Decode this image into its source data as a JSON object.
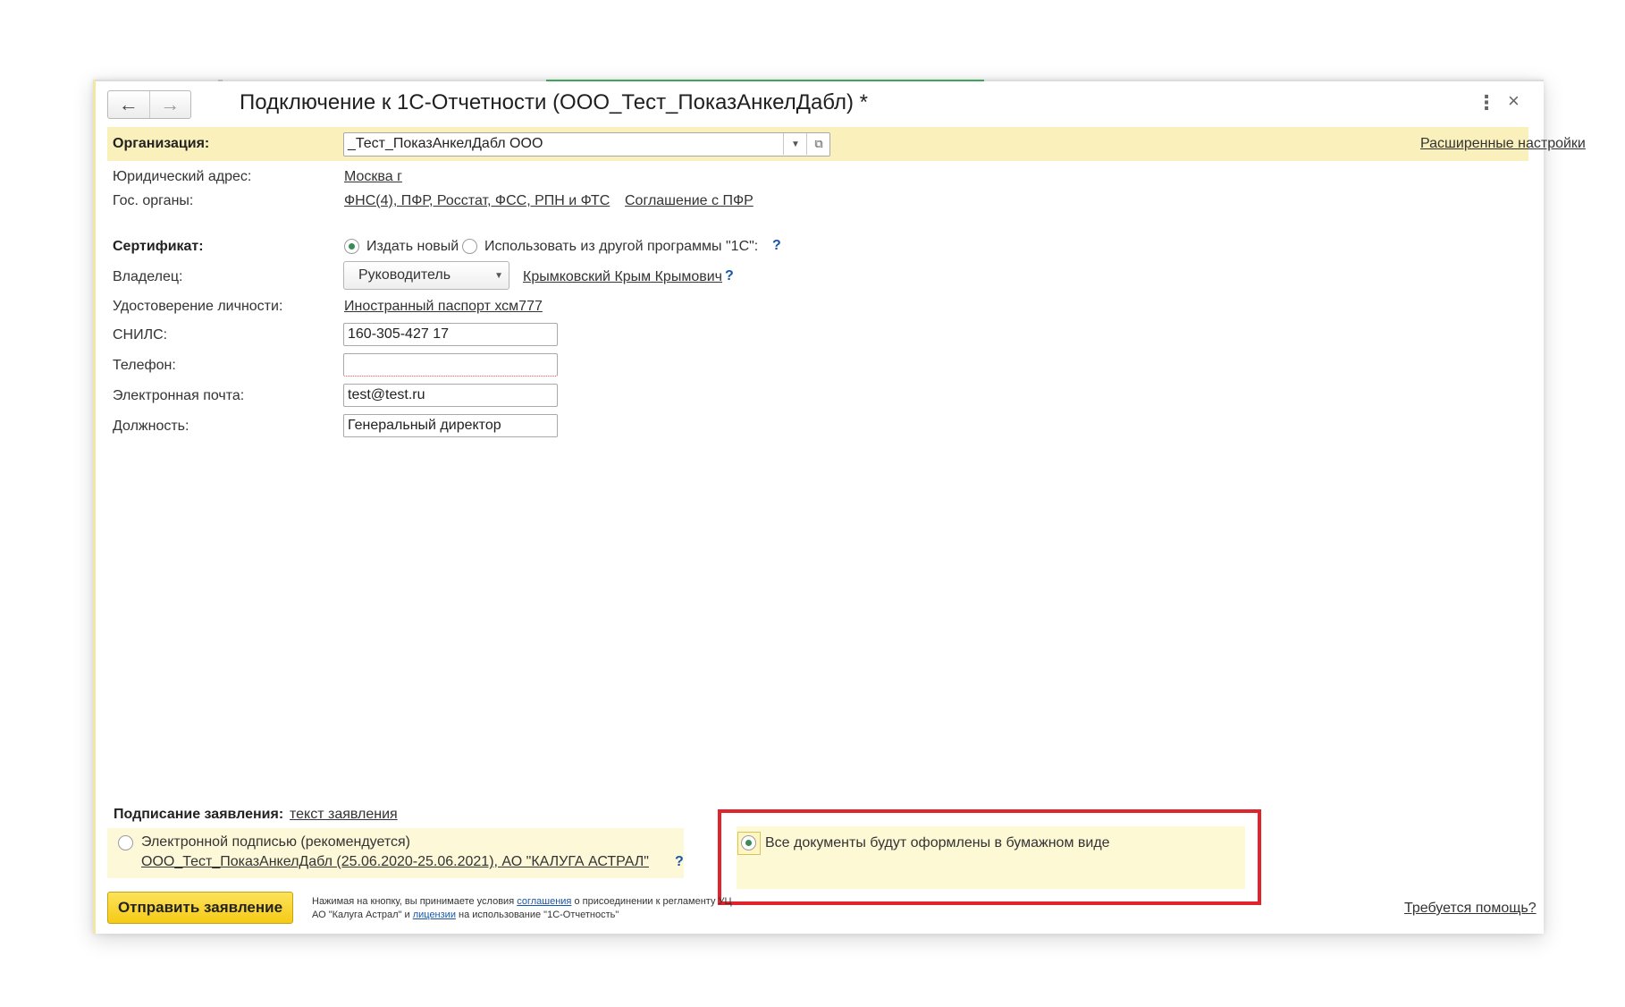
{
  "window": {
    "title": "Подключение к 1С-Отчетности (ООО_Тест_ПоказАнкелДабл) *",
    "back_icon": "arrow-left-icon",
    "forward_icon": "arrow-right-icon",
    "menu_icon": "more-vertical-icon",
    "close_icon": "close-icon"
  },
  "organization": {
    "label": "Организация:",
    "value": "_Тест_ПоказАнкелДабл ООО",
    "advanced_link": "Расширенные настройки"
  },
  "legal_address": {
    "label": "Юридический адрес:",
    "value": "Москва г"
  },
  "gov_bodies": {
    "label": "Гос. органы:",
    "value": "ФНС(4), ПФР, Росстат, ФСС, РПН и ФТС",
    "pfr_agreement_link": "Соглашение с ПФР"
  },
  "certificate": {
    "label": "Сертификат:",
    "option_new": "Издать новый",
    "option_other": "Использовать из другой программы \"1С\":",
    "selected": "new",
    "help": "?"
  },
  "owner": {
    "label": "Владелец:",
    "role": "Руководитель",
    "person_link": "Крымковский Крым Крымович",
    "help": "?"
  },
  "identity": {
    "label": "Удостоверение личности:",
    "value": "Иностранный паспорт хсм777"
  },
  "snils": {
    "label": "СНИЛС:",
    "value": "160-305-427 17"
  },
  "phone": {
    "label": "Телефон:",
    "value": ""
  },
  "email": {
    "label": "Электронная почта:",
    "value": "test@test.ru"
  },
  "position": {
    "label": "Должность:",
    "value": "Генеральный директор"
  },
  "signing": {
    "label": "Подписание заявления:",
    "text_link": "текст заявления",
    "option_esign": "Электронной подписью (рекомендуется)",
    "esign_cert_link": "ООО_Тест_ПоказАнкелДабл (25.06.2020-25.06.2021), АО \"КАЛУГА АСТРАЛ\"",
    "help": "?",
    "option_paper": "Все документы будут оформлены в бумажном виде",
    "selected": "paper"
  },
  "footer": {
    "submit_label": "Отправить заявление",
    "legal_line1_a": "Нажимая на кнопку, вы принимаете условия ",
    "legal_link_agreement": "соглашения",
    "legal_line1_b": " о присоединении к регламенту УЦ",
    "legal_line2_a": "АО \"Калуга Астрал\" и ",
    "legal_link_license": "лицензии",
    "legal_line2_b": " на использование \"1С-Отчетность\"",
    "help_link": "Требуется помощь?"
  },
  "colors": {
    "accent_yellow": "#faf0bb",
    "link_blue": "#1a56a8",
    "highlight_red": "#e0242e",
    "radio_green": "#3a8b57"
  }
}
